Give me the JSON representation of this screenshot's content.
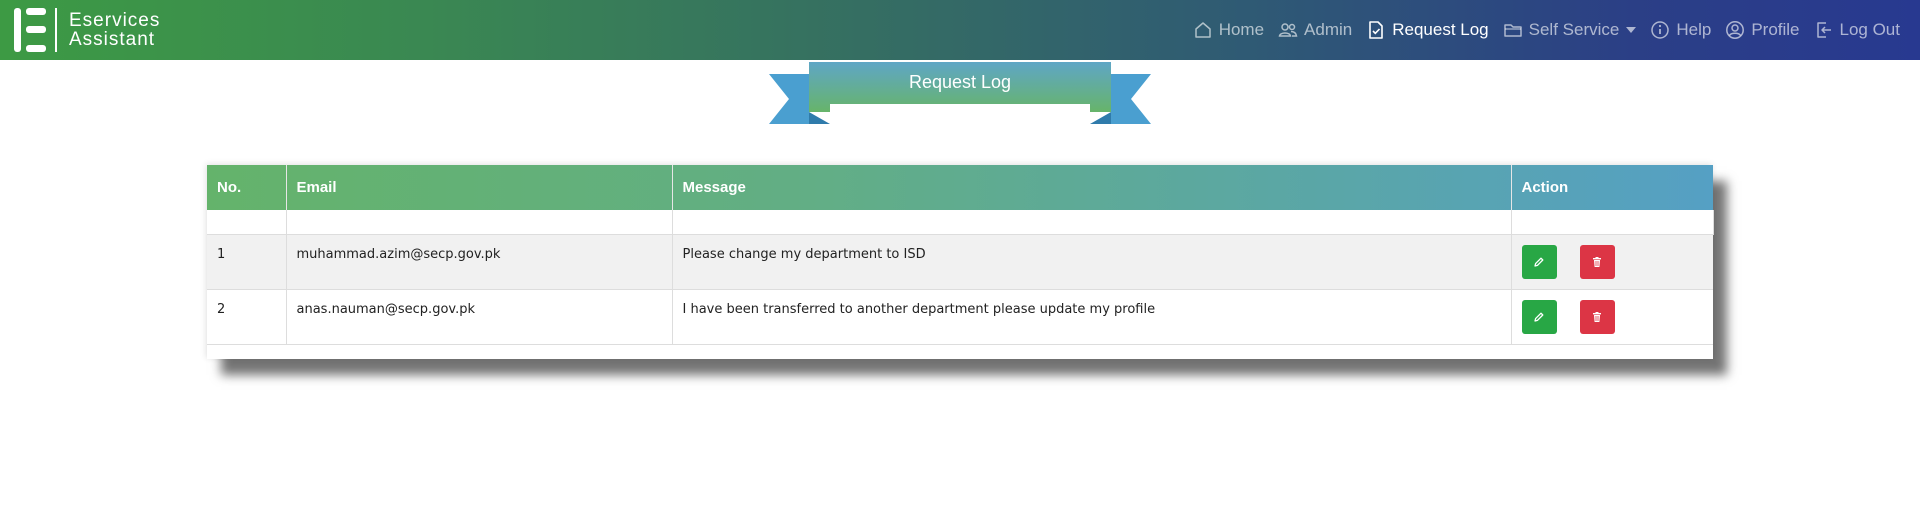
{
  "app": {
    "brand_line1": "Eservices",
    "brand_line2": "Assistant"
  },
  "nav": {
    "items": [
      {
        "label": "Home",
        "icon": "home-icon",
        "active": false
      },
      {
        "label": "Admin",
        "icon": "users-icon",
        "active": false
      },
      {
        "label": "Request Log",
        "icon": "file-check-icon",
        "active": true
      },
      {
        "label": "Self Service",
        "icon": "folder-icon",
        "active": false,
        "dropdown": true
      },
      {
        "label": "Help",
        "icon": "info-icon",
        "active": false
      },
      {
        "label": "Profile",
        "icon": "user-circle-icon",
        "active": false
      },
      {
        "label": "Log Out",
        "icon": "logout-icon",
        "active": false
      }
    ]
  },
  "page": {
    "title": "Request Log"
  },
  "table": {
    "columns": [
      "No.",
      "Email",
      "Message",
      "Action"
    ],
    "rows": [
      {
        "no": "1",
        "email": "muhammad.azim@secp.gov.pk",
        "message": "Please change my department to ISD"
      },
      {
        "no": "2",
        "email": "anas.nauman@secp.gov.pk",
        "message": "I have been transferred to another department please update my profile"
      }
    ]
  },
  "colors": {
    "nav_start": "#3d9a44",
    "nav_end": "#283990",
    "header_start": "#64b36b",
    "header_end": "#55a0c4",
    "ribbon_blue": "#4a9fd0",
    "edit_button": "#28a745",
    "delete_button": "#dc3545"
  }
}
